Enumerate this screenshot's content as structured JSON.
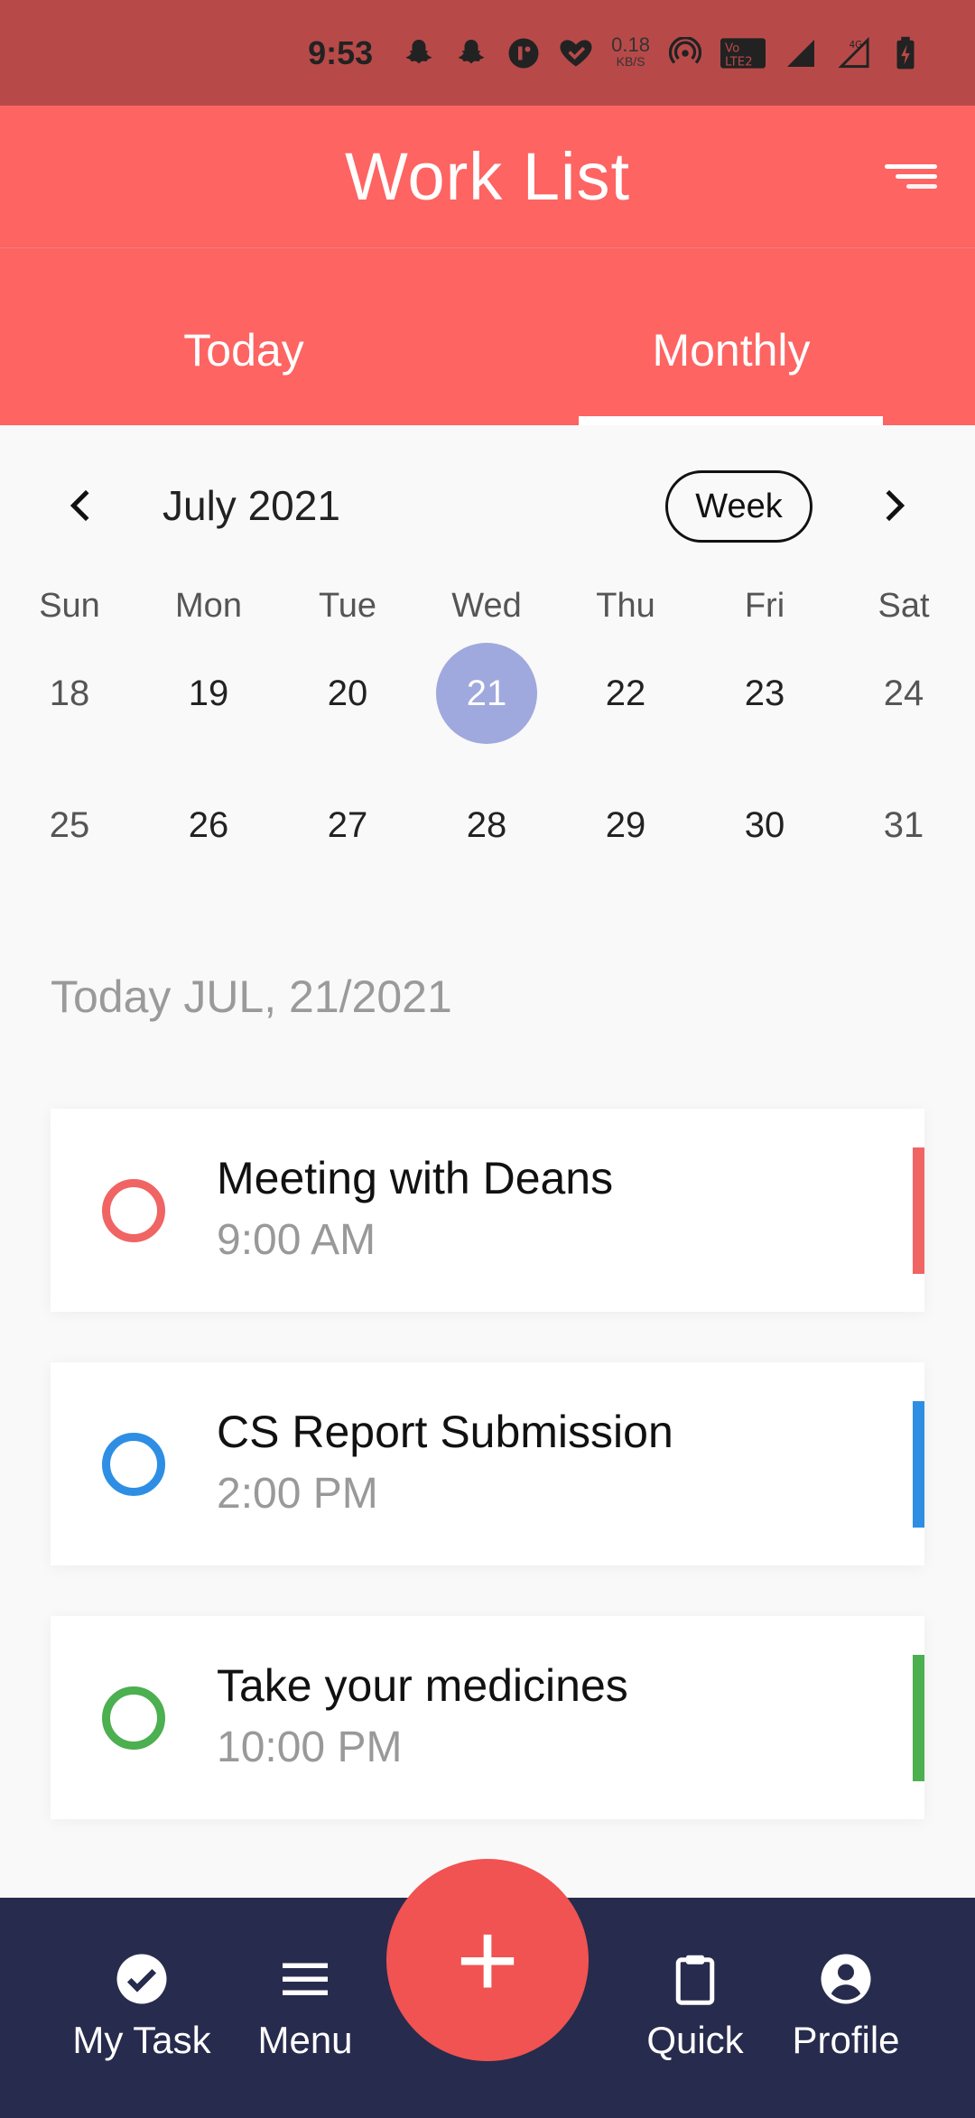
{
  "status_bar": {
    "time": "9:53",
    "speed_value": "0.18",
    "speed_unit": "KB/S",
    "icons": [
      "snapchat-icon",
      "snapchat-icon",
      "app-icon",
      "heart-check-icon",
      "hotspot-icon",
      "volte-icon",
      "signal-icon",
      "signal-4g-icon",
      "battery-charging-icon"
    ]
  },
  "header": {
    "title": "Work List",
    "menu_icon": "sort-menu-icon"
  },
  "tabs": [
    {
      "label": "Today"
    },
    {
      "label": "Monthly",
      "active": true
    }
  ],
  "calendar": {
    "month_label": "July 2021",
    "view_toggle": "Week",
    "weekdays": [
      "Sun",
      "Mon",
      "Tue",
      "Wed",
      "Thu",
      "Fri",
      "Sat"
    ],
    "weeks": [
      [
        "18",
        "19",
        "20",
        "21",
        "22",
        "23",
        "24"
      ],
      [
        "25",
        "26",
        "27",
        "28",
        "29",
        "30",
        "31"
      ]
    ],
    "selected_day": "21",
    "selected_color": "#a0a9dd"
  },
  "date_heading": "Today JUL, 21/2021",
  "tasks": [
    {
      "name": "Meeting with Deans",
      "time": "9:00 AM",
      "color": "#f06464"
    },
    {
      "name": "CS Report Submission",
      "time": "2:00 PM",
      "color": "#2d8ee4"
    },
    {
      "name": "Take your medicines",
      "time": "10:00 PM",
      "color": "#4caf50"
    }
  ],
  "bottom_nav": {
    "items": [
      {
        "label": "My Task",
        "icon": "check-circle-icon"
      },
      {
        "label": "Menu",
        "icon": "hamburger-icon"
      },
      {
        "label": "Quick",
        "icon": "clipboard-icon"
      },
      {
        "label": "Profile",
        "icon": "account-circle-icon"
      }
    ],
    "fab_symbol": "+",
    "fab_icon": "add-icon"
  },
  "colors": {
    "accent": "#fd6462",
    "status_bar": "#b74a49",
    "nav_background": "#272b4d",
    "fab": "#f05351"
  }
}
